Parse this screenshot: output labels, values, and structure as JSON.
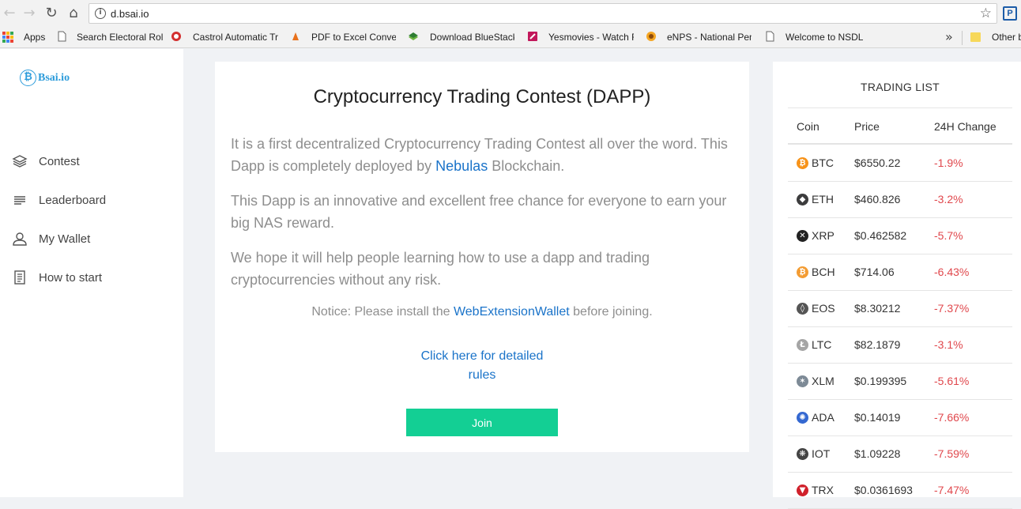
{
  "browser": {
    "url": "d.bsai.io",
    "bookmarks": [
      {
        "label": "Apps",
        "icon": "apps-grid-icon"
      },
      {
        "label": "Search Electoral Roll",
        "icon": "page-icon"
      },
      {
        "label": "Castrol Automatic Tr",
        "icon": "castrol-icon"
      },
      {
        "label": "PDF to Excel Conver",
        "icon": "pdf-icon"
      },
      {
        "label": "Download BlueStack",
        "icon": "bluestacks-icon"
      },
      {
        "label": "Yesmovies - Watch F",
        "icon": "yesmovies-icon"
      },
      {
        "label": "eNPS - National Pen",
        "icon": "enps-icon"
      },
      {
        "label": "Welcome to NSDL",
        "icon": "page-icon"
      },
      {
        "label": "Other b",
        "icon": "folder-icon"
      }
    ]
  },
  "sidebar": {
    "logo_text": "Bsai.io",
    "items": [
      {
        "label": "Contest",
        "icon": "layers-icon"
      },
      {
        "label": "Leaderboard",
        "icon": "list-icon"
      },
      {
        "label": "My Wallet",
        "icon": "user-icon"
      },
      {
        "label": "How to start",
        "icon": "document-icon"
      }
    ]
  },
  "main": {
    "title": "Cryptocurrency Trading Contest (DAPP)",
    "para1_before": "It is a first decentralized Cryptocurrency Trading Contest all over the word. This Dapp is completely deployed by ",
    "para1_link": "Nebulas",
    "para1_after": " Blockchain.",
    "para2": "This Dapp is an innovative and excellent free chance for everyone to earn your big NAS reward.",
    "para3": "We hope it will help people learning how to use a dapp and trading cryptocurrencies without any risk.",
    "notice_before": "Notice: Please install the ",
    "notice_link": "WebExtensionWallet",
    "notice_after": " before joining.",
    "rules_link": "Click here for detailed rules",
    "join_label": "Join"
  },
  "trading": {
    "title": "TRADING LIST",
    "headers": {
      "coin": "Coin",
      "price": "Price",
      "change": "24H Change"
    },
    "rows": [
      {
        "coin": "BTC",
        "price": "$6550.22",
        "change": "-1.9%",
        "icon": "bitcoin-icon",
        "color": "#f7931a"
      },
      {
        "coin": "ETH",
        "price": "$460.826",
        "change": "-3.2%",
        "icon": "ethereum-icon",
        "color": "#3c3c3d"
      },
      {
        "coin": "XRP",
        "price": "$0.462582",
        "change": "-5.7%",
        "icon": "ripple-icon",
        "color": "#222222"
      },
      {
        "coin": "BCH",
        "price": "$714.06",
        "change": "-6.43%",
        "icon": "bitcoin-cash-icon",
        "color": "#f39c33"
      },
      {
        "coin": "EOS",
        "price": "$8.30212",
        "change": "-7.37%",
        "icon": "eos-icon",
        "color": "#555555"
      },
      {
        "coin": "LTC",
        "price": "$82.1879",
        "change": "-3.1%",
        "icon": "litecoin-icon",
        "color": "#a5a5a5"
      },
      {
        "coin": "XLM",
        "price": "$0.199395",
        "change": "-5.61%",
        "icon": "stellar-icon",
        "color": "#7d8a96"
      },
      {
        "coin": "ADA",
        "price": "$0.14019",
        "change": "-7.66%",
        "icon": "cardano-icon",
        "color": "#3468d1"
      },
      {
        "coin": "IOT",
        "price": "$1.09228",
        "change": "-7.59%",
        "icon": "iota-icon",
        "color": "#444444"
      },
      {
        "coin": "TRX",
        "price": "$0.0361693",
        "change": "-7.47%",
        "icon": "tron-icon",
        "color": "#d0202b"
      }
    ]
  },
  "colors": {
    "accent": "#13cf94",
    "link": "#1a73c9",
    "negative": "#e0474c",
    "logo": "#2d9cdb"
  }
}
